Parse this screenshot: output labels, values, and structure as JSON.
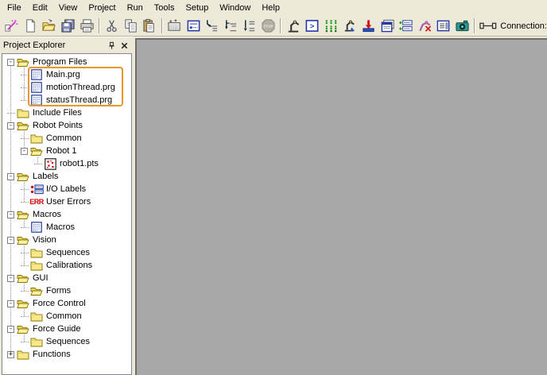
{
  "menubar": {
    "items": [
      "File",
      "Edit",
      "View",
      "Project",
      "Run",
      "Tools",
      "Setup",
      "Window",
      "Help"
    ]
  },
  "toolbar": {
    "icons": [
      "new-project-wizard-icon",
      "new-file-icon",
      "open-folder-icon",
      "save-all-icon",
      "print-icon",
      "cut-icon",
      "copy-icon",
      "paste-icon",
      "syntax-check-icon",
      "run-window-icon",
      "step-into-icon",
      "step-over-icon",
      "step-out-icon",
      "stop-icon",
      "robot-manager-icon",
      "command-window-icon",
      "io-monitor-icon",
      "simulator-icon",
      "download-icon",
      "io-label-editor-icon",
      "task-manager-icon",
      "robot-error-icon",
      "form-editor-icon",
      "vision-camera-icon",
      "connection-plug-icon"
    ],
    "stop_glyph": "STOP",
    "command_glyph": ">",
    "connection_label": "Connection:"
  },
  "panel": {
    "title": "Project Explorer",
    "pin_icon": "push-pin-icon",
    "close_icon": "close-icon"
  },
  "tree": {
    "items": [
      {
        "label": "Program Files",
        "level": 0,
        "expander": "minus",
        "icon": "folder-open"
      },
      {
        "label": "Main.prg",
        "level": 1,
        "expander": null,
        "icon": "prg"
      },
      {
        "label": "motionThread.prg",
        "level": 1,
        "expander": null,
        "icon": "prg"
      },
      {
        "label": "statusThread.prg",
        "level": 1,
        "expander": null,
        "icon": "prg"
      },
      {
        "label": "Include Files",
        "level": 0,
        "expander": null,
        "icon": "folder-closed"
      },
      {
        "label": "Robot Points",
        "level": 0,
        "expander": "minus",
        "icon": "folder-open"
      },
      {
        "label": "Common",
        "level": 1,
        "expander": null,
        "icon": "folder-closed"
      },
      {
        "label": "Robot 1",
        "level": 1,
        "expander": "minus",
        "icon": "folder-open"
      },
      {
        "label": "robot1.pts",
        "level": 2,
        "expander": null,
        "icon": "pts"
      },
      {
        "label": "Labels",
        "level": 0,
        "expander": "minus",
        "icon": "folder-open"
      },
      {
        "label": "I/O Labels",
        "level": 1,
        "expander": null,
        "icon": "iolabel"
      },
      {
        "label": "User Errors",
        "level": 1,
        "expander": null,
        "icon": "err"
      },
      {
        "label": "Macros",
        "level": 0,
        "expander": "minus",
        "icon": "folder-open"
      },
      {
        "label": "Macros",
        "level": 1,
        "expander": null,
        "icon": "prg"
      },
      {
        "label": "Vision",
        "level": 0,
        "expander": "minus",
        "icon": "folder-open"
      },
      {
        "label": "Sequences",
        "level": 1,
        "expander": null,
        "icon": "folder-closed"
      },
      {
        "label": "Calibrations",
        "level": 1,
        "expander": null,
        "icon": "folder-closed"
      },
      {
        "label": "GUI",
        "level": 0,
        "expander": "minus",
        "icon": "folder-open"
      },
      {
        "label": "Forms",
        "level": 1,
        "expander": null,
        "icon": "folder-open"
      },
      {
        "label": "Force Control",
        "level": 0,
        "expander": "minus",
        "icon": "folder-open"
      },
      {
        "label": "Common",
        "level": 1,
        "expander": null,
        "icon": "folder-closed"
      },
      {
        "label": "Force Guide",
        "level": 0,
        "expander": "minus",
        "icon": "folder-open"
      },
      {
        "label": "Sequences",
        "level": 1,
        "expander": null,
        "icon": "folder-closed"
      },
      {
        "label": "Functions",
        "level": 0,
        "expander": "plus",
        "icon": "folder-closed"
      }
    ]
  },
  "glyphs": {
    "expander_minus": "-",
    "expander_plus": "+",
    "err_label": "ERR"
  },
  "annotation": {
    "type": "highlight-rectangle",
    "color": "#E8962E",
    "highlighted_items": [
      "Main.prg",
      "motionThread.prg",
      "statusThread.prg"
    ]
  },
  "colors": {
    "chrome_bg": "#ECE9D8",
    "workspace_bg": "#A8A8A8",
    "tree_bg": "#FFFFFF",
    "folder_yellow": "#F7E88A",
    "icon_navy": "#2838A8",
    "error_red": "#D40000",
    "annotation_orange": "#E8962E"
  }
}
